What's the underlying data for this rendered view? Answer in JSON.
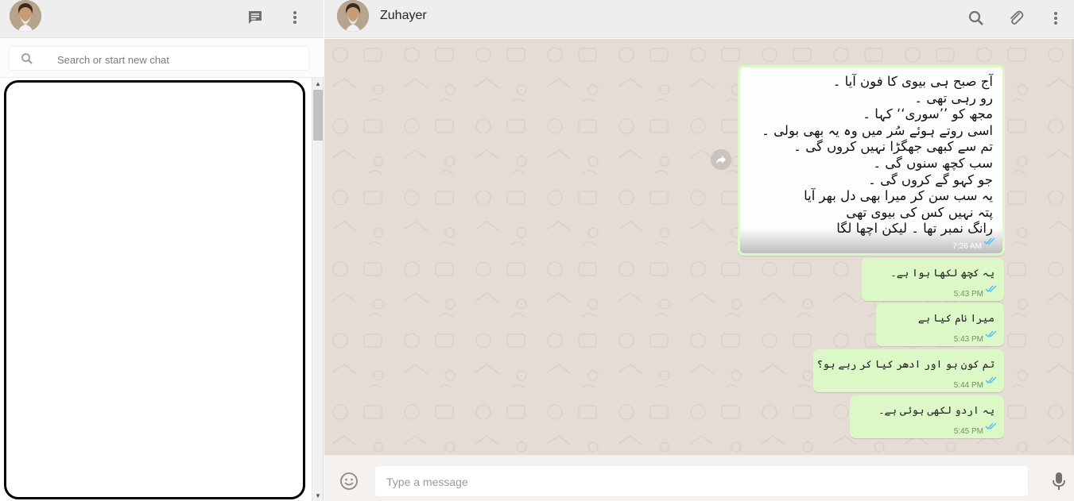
{
  "sidebar": {
    "icons": {
      "avatar": "profile-avatar",
      "new_chat": "new-chat-icon",
      "menu": "menu-icon",
      "search": "search-icon"
    },
    "search_placeholder": "Search or start new chat"
  },
  "conversation": {
    "contact_name": "Zuhayer",
    "header_icons": [
      "search-icon",
      "attach-icon",
      "menu-icon"
    ],
    "image_message": {
      "lines": [
        "آج صبح ہی بیوی کا فون آیا ۔",
        "رو رہی تھی ۔",
        "مجھ کو ’’سوری‘‘ کہا ۔",
        "اسی روتے ہوئے سُر میں وہ یہ بھی بولی ۔",
        "تم سے کبھی جھگڑا نہیں کروں گی ۔",
        "سب کچھ سنوں گی ۔",
        "جو کہو گے کروں گی ۔",
        "یہ سب سن کر میرا بھی دل بھر آیا",
        "پتہ نہیں کس کی بیوی تھی",
        "رانگ نمبر تھا ۔ لیکن اچھا لگا"
      ],
      "time": "7:26 AM"
    },
    "messages": [
      {
        "text": "یہ کچھ لکھا ہوا ہے۔",
        "time": "5:43 PM"
      },
      {
        "text": "میرا نام کیا ہے",
        "time": "5:43 PM"
      },
      {
        "text": "تم کون ہو اور ادھر کیا کر رہے ہو؟",
        "time": "5:44 PM"
      },
      {
        "text": "یہ اردو لکھی ہوئی ہے۔",
        "time": "5:45 PM"
      }
    ],
    "input_placeholder": "Type a message"
  },
  "colors": {
    "outgoing_bubble": "#dcf8c6",
    "chat_background": "#e5ddd5",
    "header_background": "#eeeeee",
    "read_ticks": "#4fc3f7"
  }
}
